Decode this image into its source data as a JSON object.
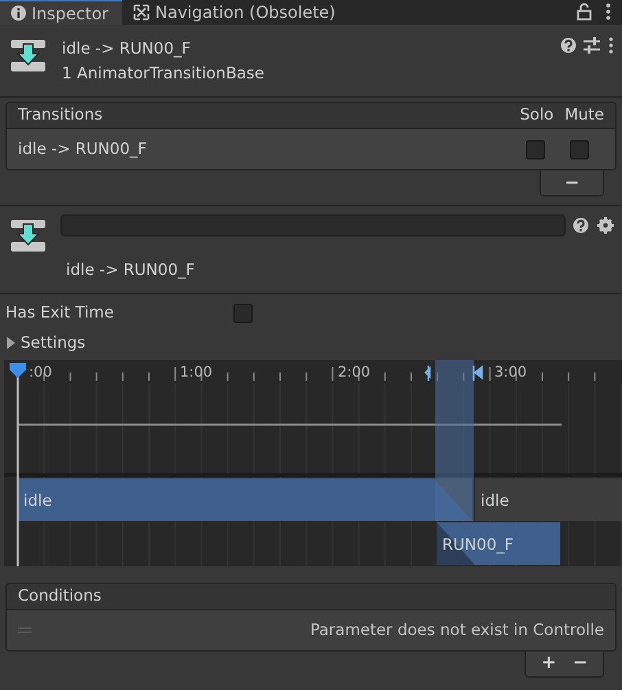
{
  "tabs": [
    {
      "label": "Inspector",
      "selected": true,
      "kind": "info"
    },
    {
      "label": "Navigation (Obsolete)",
      "selected": false,
      "kind": "navigation"
    }
  ],
  "header": {
    "title": "idle -> RUN00_F",
    "subtitle": "1 AnimatorTransitionBase"
  },
  "transitions": {
    "title": "Transitions",
    "columns": [
      "Solo",
      "Mute"
    ],
    "rows": [
      {
        "name": "idle -> RUN00_F",
        "solo": false,
        "mute": false
      }
    ],
    "footer_buttons": [
      "−"
    ]
  },
  "transition": {
    "label": "idle -> RUN00_F"
  },
  "has_exit_time": {
    "label": "Has Exit Time",
    "checked": false
  },
  "settings": {
    "label": "Settings",
    "expanded": false
  },
  "timeline": {
    "ruler": [
      ":00",
      "1:00",
      "2:00",
      "3:00"
    ],
    "clips": [
      {
        "label": "idle",
        "kind": "source"
      },
      {
        "label": "idle",
        "kind": "next"
      },
      {
        "label": "RUN00_F",
        "kind": "destination"
      }
    ]
  },
  "conditions": {
    "title": "Conditions",
    "rows": [
      {
        "text": "Parameter does not exist in Controlle"
      }
    ],
    "footer_buttons": [
      "+",
      "−"
    ]
  }
}
